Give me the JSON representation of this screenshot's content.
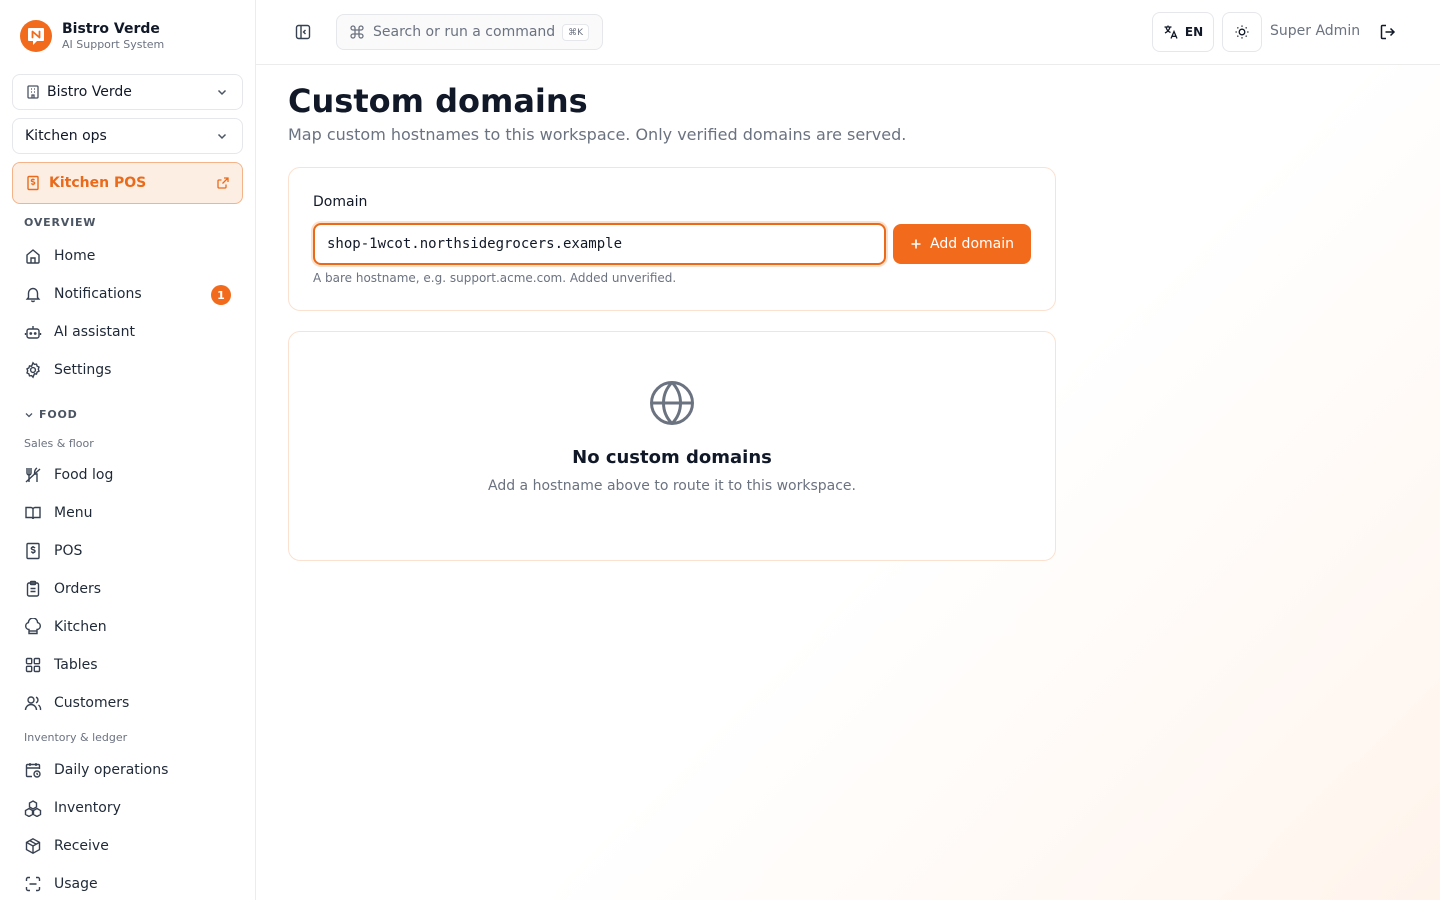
{
  "brand": {
    "name": "Bistro Verde",
    "subtitle": "AI Support System"
  },
  "workspace_select": {
    "value": "Bistro Verde"
  },
  "team_select": {
    "value": "Kitchen ops"
  },
  "pos_link": {
    "label": "Kitchen POS"
  },
  "sidebar": {
    "overview_label": "OVERVIEW",
    "overview_items": [
      {
        "label": "Home",
        "icon": "home-icon"
      },
      {
        "label": "Notifications",
        "icon": "bell-icon",
        "badge": "1"
      },
      {
        "label": "AI assistant",
        "icon": "bot-icon"
      },
      {
        "label": "Settings",
        "icon": "gear-icon"
      }
    ],
    "food_label": "FOOD",
    "sales_group": "Sales & floor",
    "sales_items": [
      {
        "label": "Food log",
        "icon": "utensils-icon"
      },
      {
        "label": "Menu",
        "icon": "book-icon"
      },
      {
        "label": "POS",
        "icon": "receipt-icon"
      },
      {
        "label": "Orders",
        "icon": "clipboard-icon"
      },
      {
        "label": "Kitchen",
        "icon": "chef-hat-icon"
      },
      {
        "label": "Tables",
        "icon": "grid-icon"
      },
      {
        "label": "Customers",
        "icon": "users-icon"
      }
    ],
    "inventory_group": "Inventory & ledger",
    "inventory_items": [
      {
        "label": "Daily operations",
        "icon": "calendar-clock-icon"
      },
      {
        "label": "Inventory",
        "icon": "boxes-icon"
      },
      {
        "label": "Receive",
        "icon": "package-icon"
      },
      {
        "label": "Usage",
        "icon": "scan-icon"
      }
    ]
  },
  "topbar": {
    "search_placeholder": "Search or run a command",
    "search_shortcut": "⌘K",
    "language": "EN",
    "user": "Super Admin"
  },
  "page": {
    "title": "Custom domains",
    "subtitle": "Map custom hostnames to this workspace. Only verified domains are served."
  },
  "form": {
    "field_label": "Domain",
    "input_value": "shop-1wcot.northsidegrocers.example",
    "add_button": "Add domain",
    "hint": "A bare hostname, e.g. support.acme.com. Added unverified."
  },
  "empty_state": {
    "title": "No custom domains",
    "subtitle": "Add a hostname above to route it to this workspace."
  },
  "colors": {
    "accent": "#f26b1d",
    "accent_bg": "#fdeee4"
  }
}
